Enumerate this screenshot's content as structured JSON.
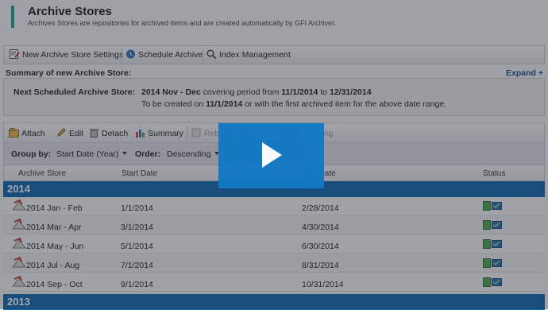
{
  "header": {
    "title": "Archive Stores",
    "subtitle": "Archives Stores are repositories for archived items and are created automatically by GFI Archiver."
  },
  "toolbar": {
    "new_settings": "New Archive Store Settings",
    "schedule": "Schedule Archive",
    "index_mgmt": "Index Management"
  },
  "summary": {
    "label": "Summary of new Archive Store:",
    "expand": "Expand +",
    "next_label": "Next Scheduled Archive Store:",
    "line1_a": "2014 Nov - Dec",
    "line1_b": " covering period from ",
    "line1_c": "11/1/2014",
    "line1_d": " to ",
    "line1_e": "12/31/2014",
    "line2_a": "To be created on ",
    "line2_b": "11/1/2014",
    "line2_c": " or with the first archived item for the above date range."
  },
  "actions": {
    "attach": "Attach",
    "edit": "Edit",
    "detach": "Detach",
    "summary": "Summary",
    "rebuild": "Rebuild Index",
    "pause": "Pause Indexing"
  },
  "grouping": {
    "group_by_label": "Group by:",
    "group_by_value": "Start Date (Year)",
    "order_label": "Order:",
    "order_value": "Descending"
  },
  "columns": {
    "store": "Archive Store",
    "start": "Start Date",
    "end": "End Date",
    "status": "Status"
  },
  "groups": [
    {
      "year": "2014",
      "rows": [
        {
          "name": "2014 Jan - Feb",
          "start": "1/1/2014",
          "end": "2/28/2014"
        },
        {
          "name": "2014 Mar - Apr",
          "start": "3/1/2014",
          "end": "4/30/2014"
        },
        {
          "name": "2014 May - Jun",
          "start": "5/1/2014",
          "end": "6/30/2014"
        },
        {
          "name": "2014 Jul - Aug",
          "start": "7/1/2014",
          "end": "8/31/2014"
        },
        {
          "name": "2014 Sep - Oct",
          "start": "9/1/2014",
          "end": "10/31/2014"
        }
      ]
    },
    {
      "year": "2013",
      "rows": []
    }
  ],
  "colors": {
    "accent": "#1aa48c",
    "year_band": "#0f67b0",
    "play": "#1179c4",
    "link": "#1d4d8c"
  }
}
